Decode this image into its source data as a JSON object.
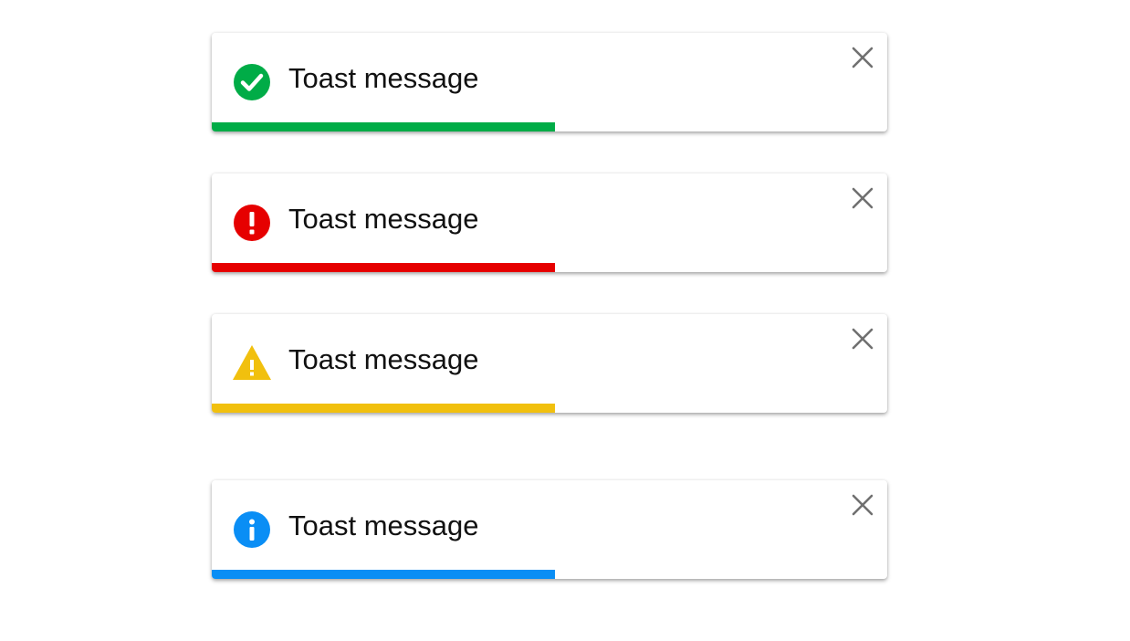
{
  "toasts": [
    {
      "type": "success",
      "message": "Toast message",
      "icon": "check-circle-icon",
      "color": "#00ac47",
      "progress": 0.508
    },
    {
      "type": "error",
      "message": "Toast message",
      "icon": "exclamation-circle-icon",
      "color": "#e60000",
      "progress": 0.508
    },
    {
      "type": "warning",
      "message": "Toast message",
      "icon": "warning-triangle-icon",
      "color": "#f1c00e",
      "progress": 0.508
    },
    {
      "type": "info",
      "message": "Toast message",
      "icon": "info-circle-icon",
      "color": "#0a8ef5",
      "progress": 0.508
    }
  ],
  "close_icon": "close-icon",
  "close_color": "#707070"
}
